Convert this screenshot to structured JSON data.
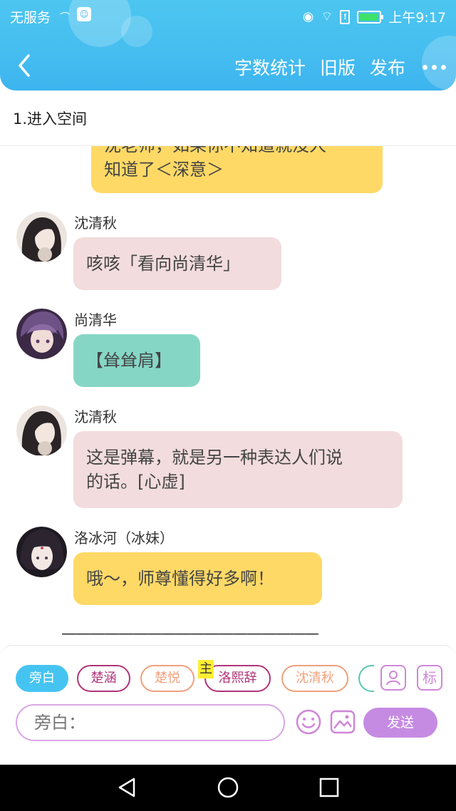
{
  "status_bar": {
    "carrier": "无服务",
    "time": "上午9:17",
    "icons": [
      "signal-icon",
      "app-notify-icon",
      "eye-icon",
      "wifi-icon",
      "sim-alert-icon",
      "battery-icon"
    ]
  },
  "nav": {
    "back_icon": "chevron-left-icon",
    "actions": [
      "字数统计",
      "旧版",
      "发布"
    ],
    "more_icon": "more-dots-icon"
  },
  "chapter": {
    "title": "1.进入空间"
  },
  "messages": [
    {
      "speaker": "",
      "lines": [
        "沈老师，如果你不知道就没人",
        "知道了＜深意＞"
      ],
      "color": "yellow",
      "partial": true
    },
    {
      "speaker": "沈清秋",
      "lines": [
        "咳咳「看向尚清华」"
      ],
      "color": "pink"
    },
    {
      "speaker": "尚清华",
      "lines": [
        "【耸耸肩】"
      ],
      "color": "teal"
    },
    {
      "speaker": "沈清秋",
      "lines": [
        "这是弹幕，就是另一种表达人们说",
        "的话。[心虚]"
      ],
      "color": "pink"
    },
    {
      "speaker": "洛冰河（冰妹）",
      "lines": [
        "哦～，师尊懂得好多啊！"
      ],
      "color": "yellow"
    }
  ],
  "divider": "——————————————————",
  "composer": {
    "roles": [
      "旁白",
      "楚涵",
      "楚悦",
      "洛熙辞",
      "沈清秋"
    ],
    "main_badge": "主",
    "mark_label": "标",
    "input_placeholder": "旁白：",
    "send_label": "发送",
    "colors": {
      "narration": "#45c4f2",
      "send": "#c58be2",
      "accent": "#b0347a"
    }
  }
}
